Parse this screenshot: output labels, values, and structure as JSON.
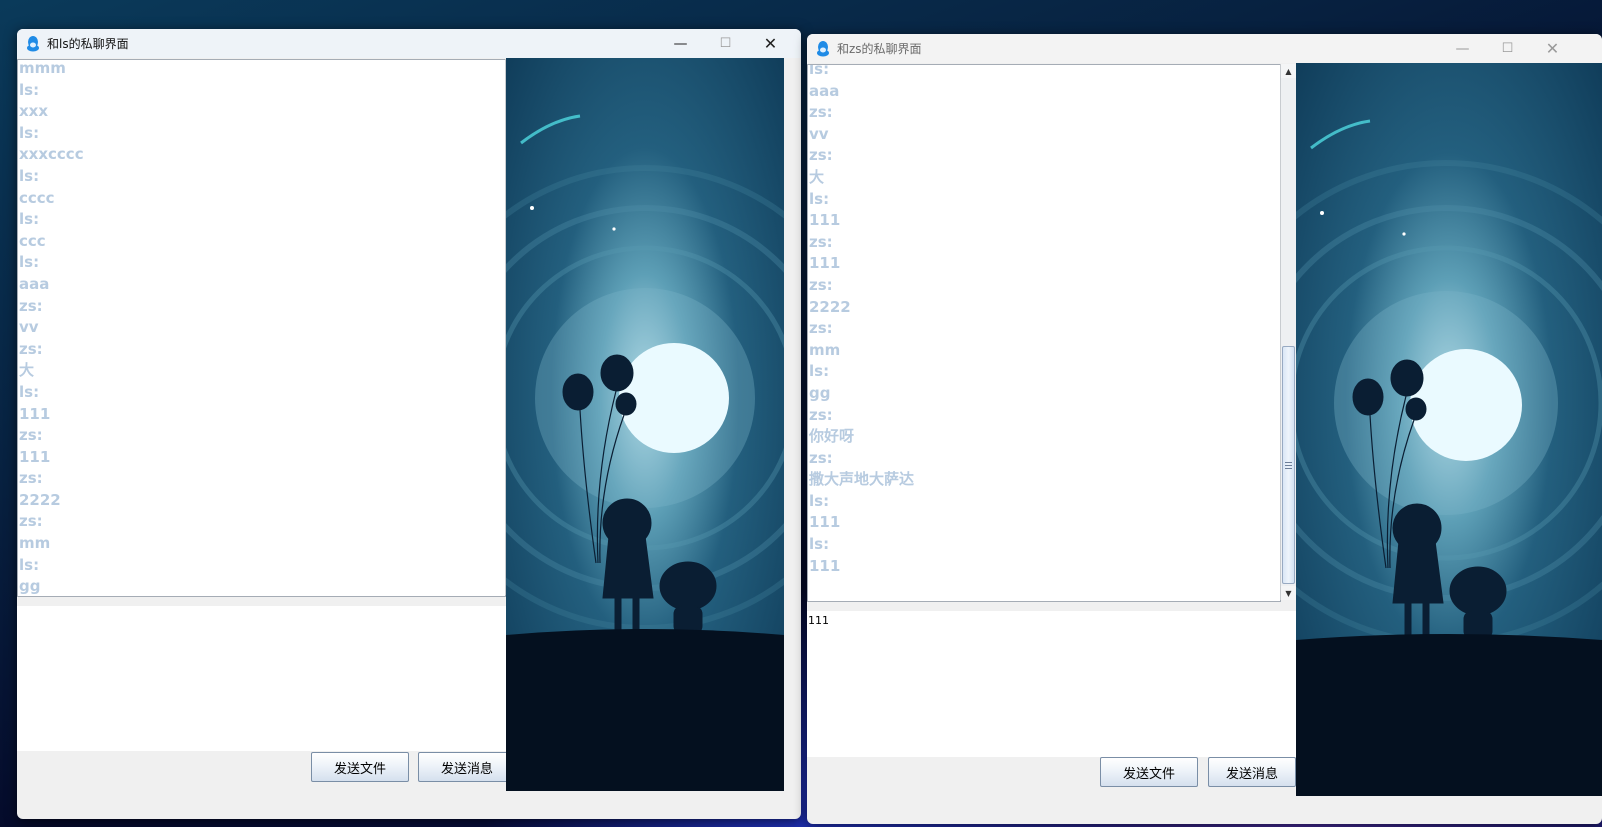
{
  "window_left": {
    "title": "和ls的私聊界面",
    "messages": [
      "mmm",
      "ls:",
      "xxx",
      "ls:",
      "xxxcccc",
      "ls:",
      "cccc",
      "ls:",
      "ccc",
      "ls:",
      "aaa",
      "zs:",
      "vv",
      "zs:",
      "大",
      "ls:",
      "111",
      "zs:",
      "111",
      "zs:",
      "2222",
      "zs:",
      "mm",
      "ls:",
      "gg"
    ],
    "input_value": "",
    "send_file_label": "发送文件",
    "send_message_label": "发送消息",
    "minimize_glyph": "—",
    "maximize_glyph": "☐",
    "close_glyph": "✕",
    "icons": [
      "qq-penguin-icon",
      "minimize-icon",
      "maximize-icon",
      "close-icon",
      "scroll-up-arrow-icon",
      "scroll-down-arrow-icon"
    ]
  },
  "window_right": {
    "title": "和zs的私聊界面",
    "messages": [
      "ls:",
      "aaa",
      "zs:",
      "vv",
      "zs:",
      "大",
      "ls:",
      "111",
      "zs:",
      "111",
      "zs:",
      "2222",
      "zs:",
      "mm",
      "ls:",
      "gg",
      "zs:",
      "你好呀",
      "zs:",
      "撒大声地大萨达",
      "ls:",
      "111",
      "ls:",
      "111"
    ],
    "input_value": "111",
    "send_file_label": "发送文件",
    "send_message_label": "发送消息",
    "minimize_glyph": "—",
    "maximize_glyph": "☐",
    "close_glyph": "✕",
    "icons": [
      "qq-penguin-icon",
      "minimize-icon",
      "maximize-icon",
      "close-icon",
      "scroll-up-arrow-icon",
      "scroll-down-arrow-icon"
    ]
  },
  "scroll_position": {
    "left_chat_scroll_fraction": 0.55,
    "right_chat_scroll_fraction": 0.65
  },
  "colors": {
    "message_text": "#b7cbe0",
    "illustration_sky": "#134a66",
    "illustration_moon": "#eafaff",
    "illustration_ground": "#04101f"
  }
}
